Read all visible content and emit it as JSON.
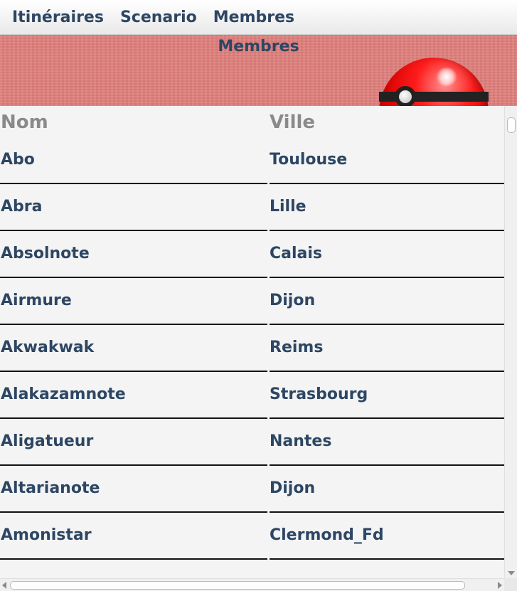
{
  "menu": {
    "items": [
      {
        "label": "Itinéraires"
      },
      {
        "label": "Scenario"
      },
      {
        "label": "Membres"
      }
    ]
  },
  "banner": {
    "title": "Membres",
    "icon": "pokeball-icon"
  },
  "table": {
    "columns": [
      "Nom",
      "Ville"
    ],
    "rows": [
      {
        "nom": "Abo",
        "ville": "Toulouse"
      },
      {
        "nom": "Abra",
        "ville": "Lille"
      },
      {
        "nom": "Absolnote",
        "ville": "Calais"
      },
      {
        "nom": "Airmure",
        "ville": "Dijon"
      },
      {
        "nom": "Akwakwak",
        "ville": "Reims"
      },
      {
        "nom": "Alakazamnote",
        "ville": "Strasbourg"
      },
      {
        "nom": "Aligatueur",
        "ville": "Nantes"
      },
      {
        "nom": "Altarianote",
        "ville": "Dijon"
      },
      {
        "nom": "Amonistar",
        "ville": "Clermond_Fd"
      }
    ]
  },
  "colors": {
    "text_primary": "#2d4663",
    "header_text": "#8a8a8a",
    "banner_bg": "#e07f7c",
    "table_bg": "#f4f4f4"
  }
}
